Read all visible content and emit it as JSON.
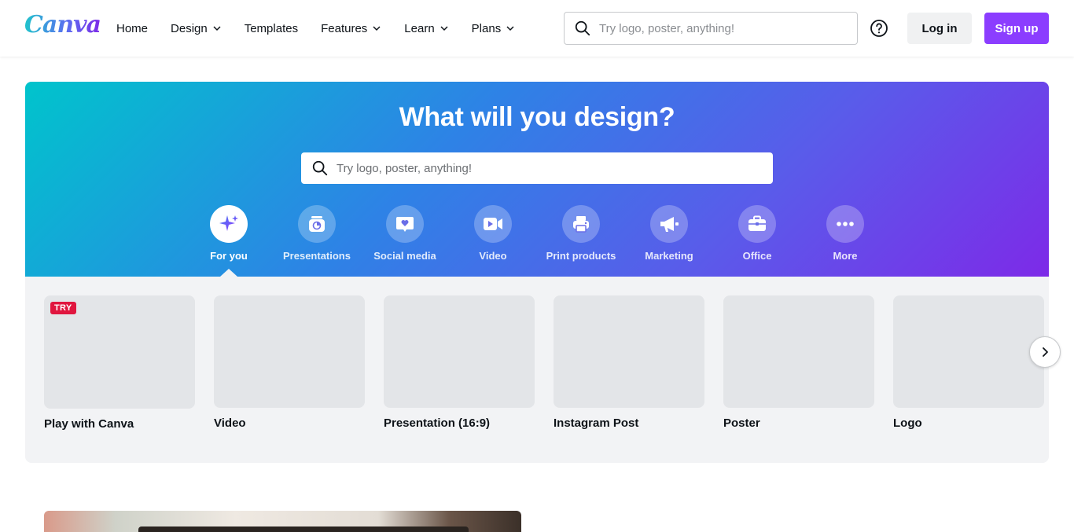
{
  "header": {
    "logo": "Canva",
    "nav": [
      {
        "label": "Home",
        "dropdown": false
      },
      {
        "label": "Design",
        "dropdown": true
      },
      {
        "label": "Templates",
        "dropdown": false
      },
      {
        "label": "Features",
        "dropdown": true
      },
      {
        "label": "Learn",
        "dropdown": true
      },
      {
        "label": "Plans",
        "dropdown": true
      }
    ],
    "search_placeholder": "Try logo, poster, anything!",
    "login_label": "Log in",
    "signup_label": "Sign up"
  },
  "hero": {
    "title": "What will you design?",
    "search_placeholder": "Try logo, poster, anything!",
    "categories": [
      {
        "label": "For you",
        "icon": "sparkle-icon",
        "active": true
      },
      {
        "label": "Presentations",
        "icon": "presentation-icon",
        "active": false
      },
      {
        "label": "Social media",
        "icon": "heart-chat-icon",
        "active": false
      },
      {
        "label": "Video",
        "icon": "video-camera-icon",
        "active": false
      },
      {
        "label": "Print products",
        "icon": "printer-icon",
        "active": false
      },
      {
        "label": "Marketing",
        "icon": "megaphone-icon",
        "active": false
      },
      {
        "label": "Office",
        "icon": "briefcase-icon",
        "active": false
      },
      {
        "label": "More",
        "icon": "more-dots-icon",
        "active": false
      }
    ]
  },
  "designs": [
    {
      "label": "Play with Canva",
      "badge": "TRY"
    },
    {
      "label": "Video",
      "badge": ""
    },
    {
      "label": "Presentation (16:9)",
      "badge": ""
    },
    {
      "label": "Instagram Post",
      "badge": ""
    },
    {
      "label": "Poster",
      "badge": ""
    },
    {
      "label": "Logo",
      "badge": ""
    }
  ],
  "colors": {
    "brand_purple": "#8b3dff",
    "gradient_start": "#00c4cc",
    "gradient_end": "#7d2ae8",
    "try_badge": "#e0163f"
  }
}
